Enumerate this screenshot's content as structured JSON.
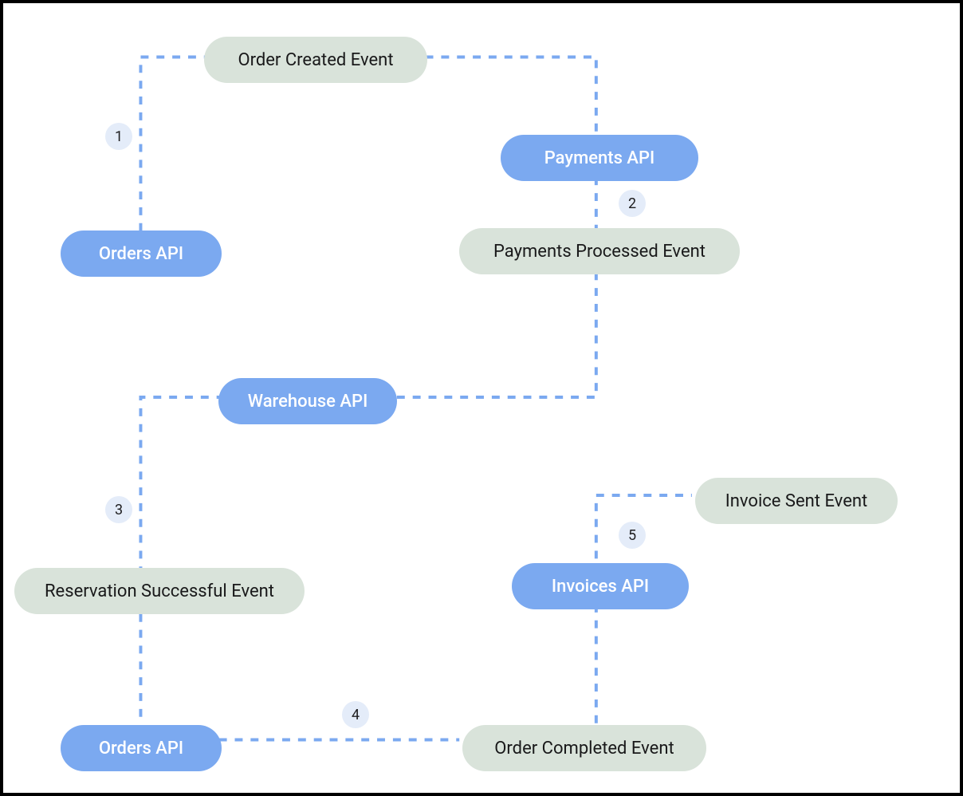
{
  "nodes": {
    "orders_api_top": {
      "label": "Orders API"
    },
    "payments_api": {
      "label": "Payments API"
    },
    "warehouse_api": {
      "label": "Warehouse API"
    },
    "orders_api_bottom": {
      "label": "Orders API"
    },
    "invoices_api": {
      "label": "Invoices API"
    }
  },
  "events": {
    "order_created": {
      "label": "Order Created Event"
    },
    "payments_processed": {
      "label": "Payments Processed Event"
    },
    "reservation_success": {
      "label": "Reservation Successful Event"
    },
    "order_completed": {
      "label": "Order Completed Event"
    },
    "invoice_sent": {
      "label": "Invoice Sent Event"
    }
  },
  "steps": {
    "s1": "1",
    "s2": "2",
    "s3": "3",
    "s4": "4",
    "s5": "5"
  },
  "colors": {
    "api_fill": "#7ba9f0",
    "event_fill": "#d9e3da",
    "connector": "#7ba9f0",
    "badge_fill": "#e4ecf9"
  }
}
